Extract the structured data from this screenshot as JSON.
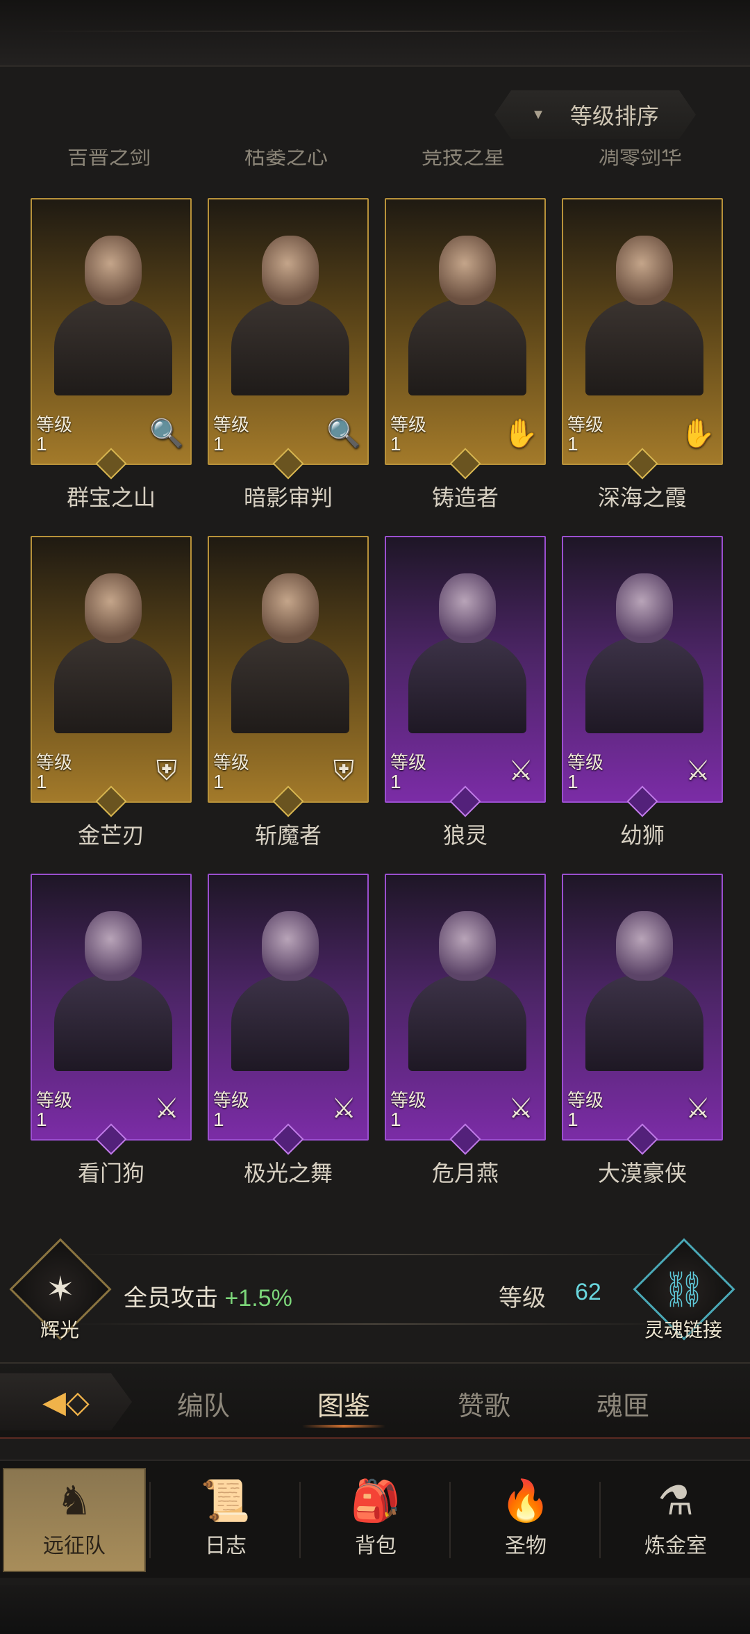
{
  "header": {
    "sort_label": "等级排序",
    "sort_icon": "caret-down-icon"
  },
  "cut_names": [
    "吉普之剑",
    "枯萎之心",
    "竞技之星",
    "凋零剑华"
  ],
  "heroes": [
    {
      "name": "群宝之山",
      "level_label": "等级",
      "level": "1",
      "rarity": "gold",
      "class_icon": "staff-icon",
      "glyph": "🔍"
    },
    {
      "name": "暗影审判",
      "level_label": "等级",
      "level": "1",
      "rarity": "gold",
      "class_icon": "staff-icon",
      "glyph": "🔍"
    },
    {
      "name": "铸造者",
      "level_label": "等级",
      "level": "1",
      "rarity": "gold",
      "class_icon": "palm-icon",
      "glyph": "✋"
    },
    {
      "name": "深海之霞",
      "level_label": "等级",
      "level": "1",
      "rarity": "gold",
      "class_icon": "palm-icon",
      "glyph": "✋"
    },
    {
      "name": "金芒刃",
      "level_label": "等级",
      "level": "1",
      "rarity": "gold",
      "class_icon": "shield-icon",
      "glyph": "⛨"
    },
    {
      "name": "斩魔者",
      "level_label": "等级",
      "level": "1",
      "rarity": "gold",
      "class_icon": "shield-icon",
      "glyph": "⛨"
    },
    {
      "name": "狼灵",
      "level_label": "等级",
      "level": "1",
      "rarity": "purple",
      "class_icon": "sword-icon",
      "glyph": "⚔"
    },
    {
      "name": "幼狮",
      "level_label": "等级",
      "level": "1",
      "rarity": "purple",
      "class_icon": "sword-icon",
      "glyph": "⚔"
    },
    {
      "name": "看门狗",
      "level_label": "等级",
      "level": "1",
      "rarity": "purple",
      "class_icon": "sword-icon",
      "glyph": "⚔"
    },
    {
      "name": "极光之舞",
      "level_label": "等级",
      "level": "1",
      "rarity": "purple",
      "class_icon": "sword-icon",
      "glyph": "⚔"
    },
    {
      "name": "危月燕",
      "level_label": "等级",
      "level": "1",
      "rarity": "purple",
      "class_icon": "sword-icon",
      "glyph": "⚔"
    },
    {
      "name": "大漠豪侠",
      "level_label": "等级",
      "level": "1",
      "rarity": "purple",
      "class_icon": "sword-icon",
      "glyph": "⚔"
    }
  ],
  "bonus": {
    "left_label": "辉光",
    "stat_label": "全员攻击",
    "stat_value": "+1.5%",
    "level_label": "等级",
    "level_value": "62",
    "right_label": "灵魂链接",
    "left_icon": "compass-star-icon",
    "right_icon": "chain-link-icon"
  },
  "tabs": [
    {
      "label": "编队",
      "active": false
    },
    {
      "label": "图鉴",
      "active": true
    },
    {
      "label": "赞歌",
      "active": false
    },
    {
      "label": "魂匣",
      "active": false
    }
  ],
  "bottom_nav": [
    {
      "label": "远征队",
      "icon": "horned-helmet-icon",
      "glyph": "♞",
      "active": true
    },
    {
      "label": "日志",
      "icon": "scroll-icon",
      "glyph": "📜",
      "active": false
    },
    {
      "label": "背包",
      "icon": "bag-icon",
      "glyph": "🎒",
      "active": false
    },
    {
      "label": "圣物",
      "icon": "torch-icon",
      "glyph": "🔥",
      "active": false
    },
    {
      "label": "炼金室",
      "icon": "alchemy-icon",
      "glyph": "⚗",
      "active": false
    }
  ],
  "colors": {
    "gold_frame": "#b8923a",
    "purple_frame": "#9b4fd0",
    "bonus_green": "#7cd67a",
    "level_cyan": "#69d6dd",
    "tab_accent": "#d07030"
  }
}
